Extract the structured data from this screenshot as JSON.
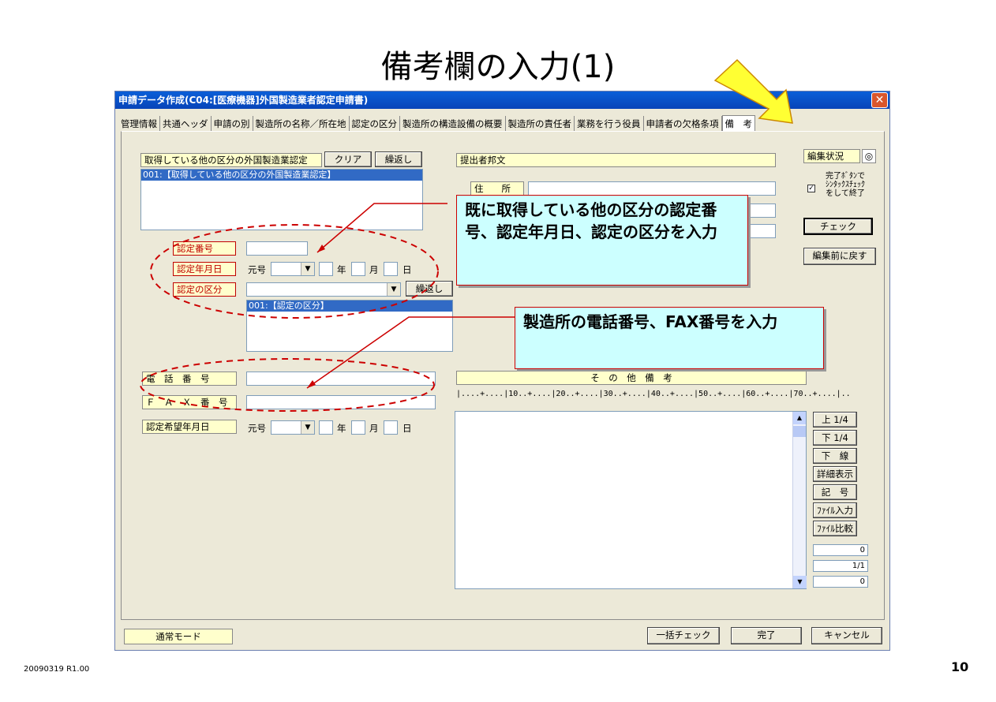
{
  "slide": {
    "title": "備考欄の入力(1)",
    "footer_left": "20090319 R1.00",
    "page_number": "10"
  },
  "window": {
    "title": "申請データ作成(C04:[医療機器]外国製造業者認定申請書)",
    "close_glyph": "✕"
  },
  "tabs": [
    "管理情報",
    "共通ヘッダ",
    "申請の別",
    "製造所の名称／所在地",
    "認定の区分",
    "製造所の構造設備の概要",
    "製造所の責任者",
    "業務を行う役員",
    "申請者の欠格条項",
    "備　考"
  ],
  "active_tab_index": 9,
  "left": {
    "other_category_label": "取得している他の区分の外国製造業認定",
    "clear_button": "クリア",
    "repeat_button": "繰返し",
    "list_item": "001:【取得している他の区分の外国製造業認定】",
    "cert_number_label": "認定番号",
    "cert_date_label": "認定年月日",
    "era_label": "元号",
    "year_label": "年",
    "month_label": "月",
    "day_label": "日",
    "cert_category_label": "認定の区分",
    "category_repeat_button": "繰返し",
    "category_list_item": "001:【認定の区分】",
    "phone_label": "電　話　番　号",
    "fax_label": "Ｆ　Ａ　Ｘ　番　号",
    "desired_date_label": "認定希望年月日"
  },
  "middle": {
    "submitter_label": "提出者邦文",
    "address_label": "住　　所",
    "other_remarks_label": "そ　の　他　備　考",
    "ruler": "|....+....|10..+....|20..+....|30..+....|40..+....|50..+....|60..+....|70..+....|.."
  },
  "right": {
    "edit_status_label": "編集状況",
    "edit_status_icon": "◎",
    "syntax_check_text": "完了ﾎﾞﾀﾝで\nｼﾝﾀｯｸｽﾁｪｯｸ\nをして終了",
    "check_button": "チェック",
    "revert_button": "編集前に戻す",
    "up_button": "上 1/4",
    "down_button": "下 1/4",
    "underline_button": "下　線",
    "detail_button": "詳細表示",
    "symbol_button": "記　号",
    "file_input_button": "ﾌｧｲﾙ入力",
    "file_compare_button": "ﾌｧｲﾙ比較",
    "counter1": "0",
    "counter2": "1/1",
    "counter3": "0"
  },
  "bottom": {
    "mode_label": "通常モード",
    "bulk_check_button": "一括チェック",
    "done_button": "完了",
    "cancel_button": "キャンセル"
  },
  "callouts": {
    "cert_info": "既に取得している他の区分の認定番号、認定年月日、認定の区分を入力",
    "phone_fax": "製造所の電話番号、FAX番号を入力"
  },
  "colors": {
    "accent_red": "#cc0000",
    "callout_bg": "#ccffff",
    "arrow_yellow": "#ffff33",
    "label_bg": "#ffffcc",
    "selection": "#316ac5"
  }
}
